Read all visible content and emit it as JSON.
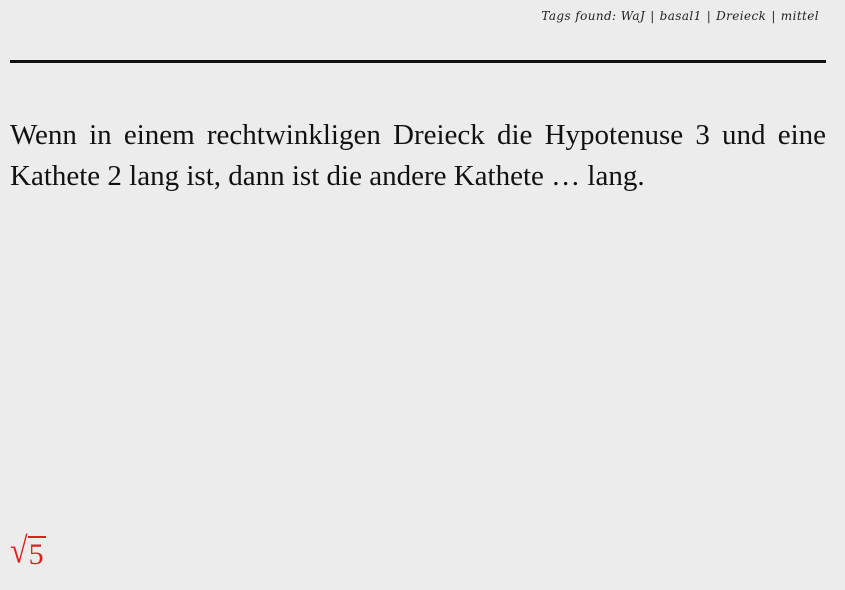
{
  "tags": {
    "prefix": "Tags found:",
    "items": [
      "WaJ",
      "basal1",
      "Dreieck",
      "mittel"
    ],
    "separator": "|"
  },
  "question": {
    "text": "Wenn in einem rechtwinkligen Dreieck die Hypotenuse 3 und eine Kathete 2 lang ist, dann ist die andere Kathete … lang."
  },
  "answer": {
    "radical_symbol": "√",
    "radicand": "5",
    "color": "#e02020"
  }
}
